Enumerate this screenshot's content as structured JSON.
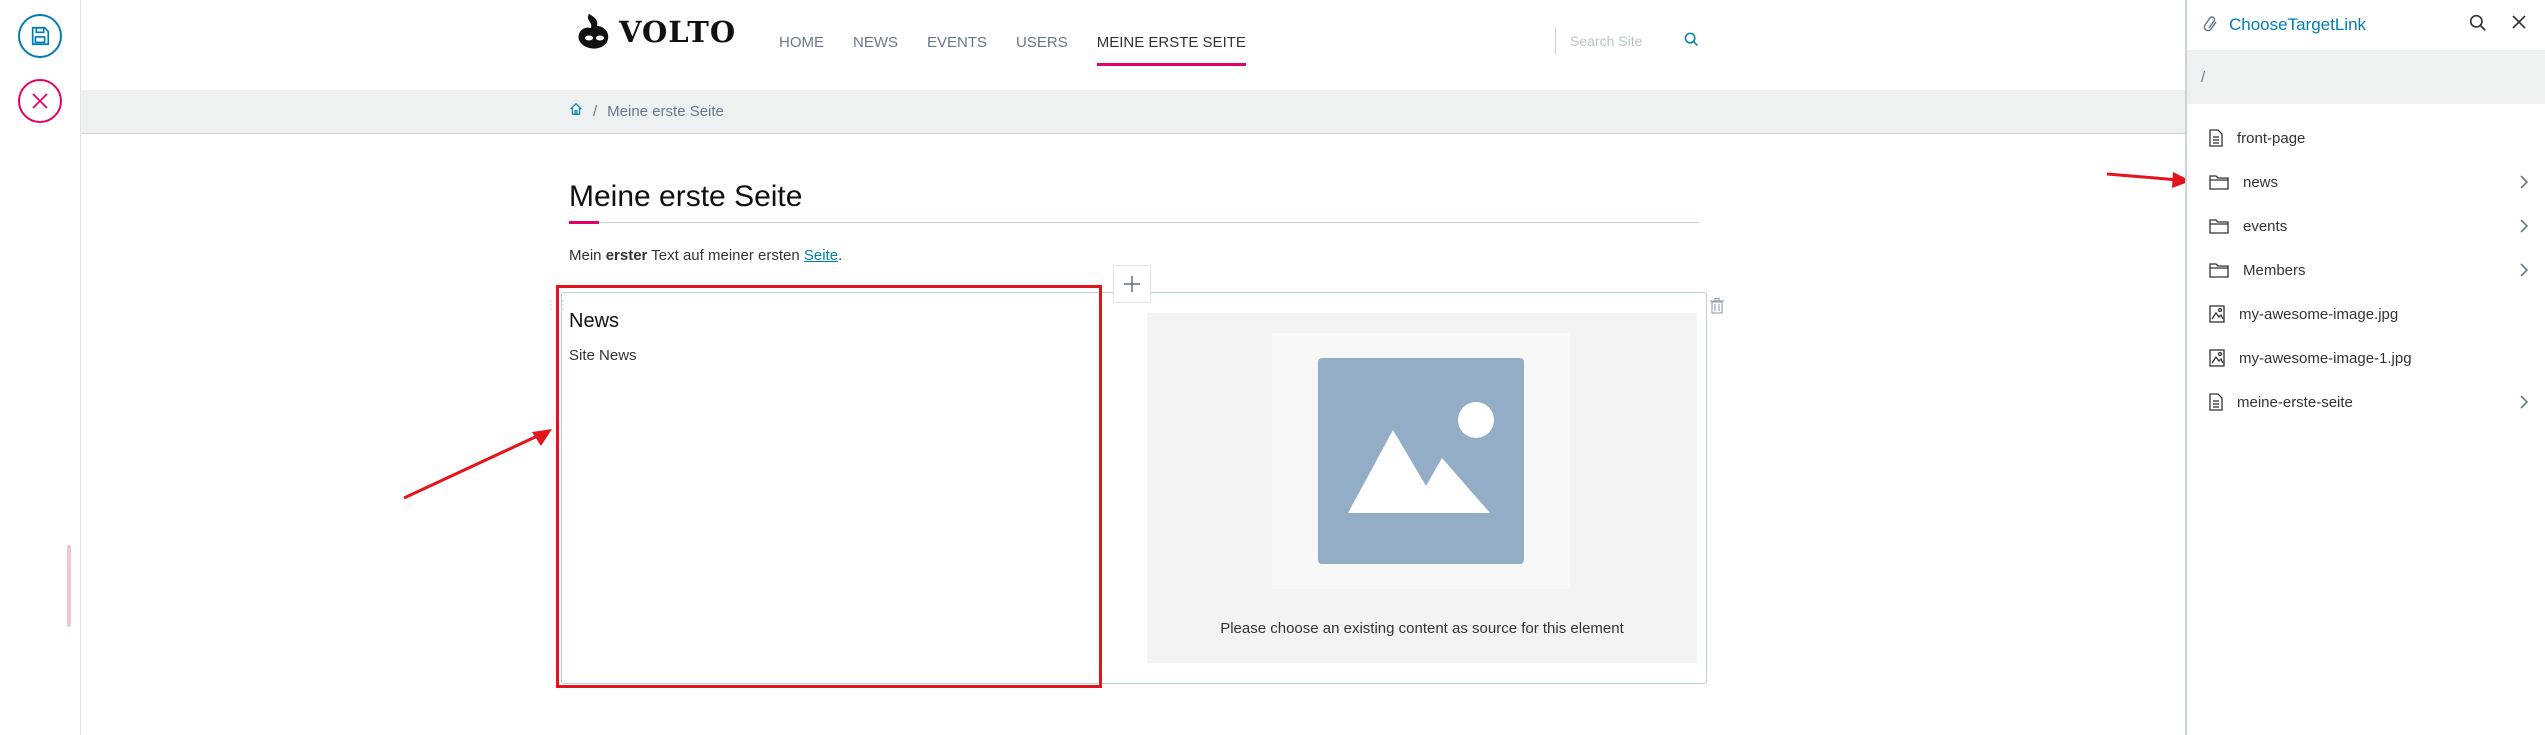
{
  "toolbar": {
    "save_icon": "save-icon",
    "cancel_icon": "close-icon"
  },
  "header": {
    "logo_text": "VOLTO",
    "nav": [
      {
        "label": "HOME",
        "active": false
      },
      {
        "label": "NEWS",
        "active": false
      },
      {
        "label": "EVENTS",
        "active": false
      },
      {
        "label": "USERS",
        "active": false
      },
      {
        "label": "MEINE ERSTE SEITE",
        "active": true
      }
    ],
    "search_placeholder": "Search Site"
  },
  "breadcrumbs": {
    "separator": "/",
    "current": "Meine erste Seite"
  },
  "page": {
    "title": "Meine erste Seite",
    "text_before": "Mein ",
    "text_bold": "erster",
    "text_middle": " Text auf meiner ersten ",
    "text_link": "Seite",
    "text_after": "."
  },
  "teaser_block": {
    "title": "News",
    "description": "Site News",
    "placeholder_message": "Please choose an existing content as source for this element"
  },
  "sidebar": {
    "title": "ChooseTargetLink",
    "path": "/",
    "items": [
      {
        "label": "front-page",
        "icon": "document-icon",
        "has_children": false
      },
      {
        "label": "news",
        "icon": "folder-icon",
        "has_children": true
      },
      {
        "label": "events",
        "icon": "folder-icon",
        "has_children": true
      },
      {
        "label": "Members",
        "icon": "folder-icon",
        "has_children": true
      },
      {
        "label": "my-awesome-image.jpg",
        "icon": "image-icon",
        "has_children": false
      },
      {
        "label": "my-awesome-image-1.jpg",
        "icon": "image-icon",
        "has_children": false
      },
      {
        "label": "meine-erste-seite",
        "icon": "document-icon",
        "has_children": true
      }
    ]
  },
  "colors": {
    "accent": "#007eb1",
    "highlight": "#e40166",
    "annotation_red": "#e4141c"
  }
}
